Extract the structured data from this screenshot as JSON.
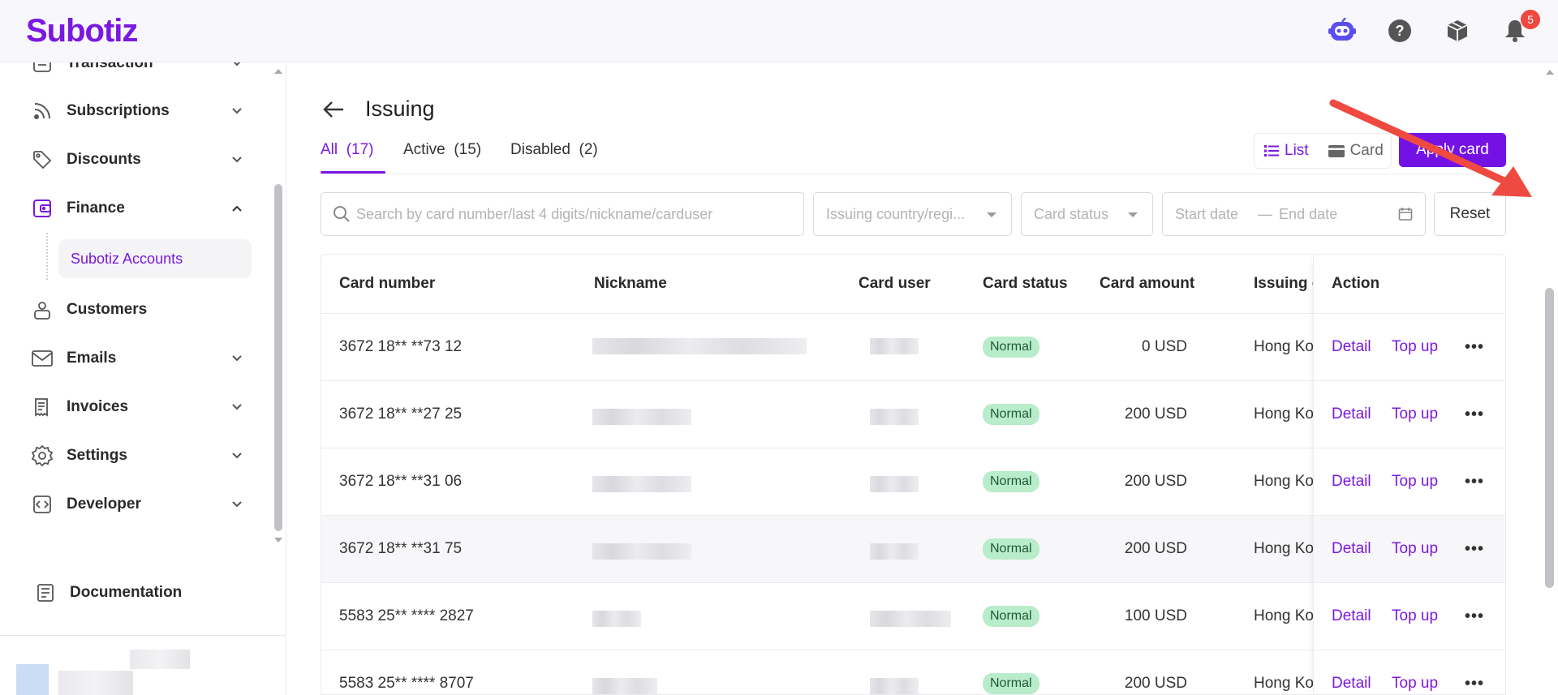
{
  "brand": {
    "name": "Subotiz",
    "color": "#7b18e0"
  },
  "header": {
    "icons": [
      "bot-icon",
      "help-icon",
      "package-icon",
      "bell-icon"
    ],
    "notification_count": "5"
  },
  "sidebar": {
    "items": [
      {
        "label": "Transaction",
        "icon": "receipt-icon",
        "expandable": true
      },
      {
        "label": "Subscriptions",
        "icon": "rss-icon",
        "expandable": true
      },
      {
        "label": "Discounts",
        "icon": "tag-icon",
        "expandable": true
      },
      {
        "label": "Finance",
        "icon": "wallet-icon",
        "expandable": true,
        "expanded": true
      },
      {
        "label": "Customers",
        "icon": "user-icon",
        "expandable": false
      },
      {
        "label": "Emails",
        "icon": "mail-icon",
        "expandable": true
      },
      {
        "label": "Invoices",
        "icon": "invoice-icon",
        "expandable": true
      },
      {
        "label": "Settings",
        "icon": "gear-icon",
        "expandable": true
      },
      {
        "label": "Developer",
        "icon": "code-icon",
        "expandable": true
      }
    ],
    "finance_sub": {
      "label": "Subotiz Accounts"
    },
    "documentation": {
      "label": "Documentation"
    }
  },
  "page": {
    "title": "Issuing",
    "tabs": [
      {
        "label": "All",
        "count": "(17)",
        "active": true
      },
      {
        "label": "Active",
        "count": "(15)"
      },
      {
        "label": "Disabled",
        "count": "(2)"
      }
    ],
    "view_toggle": {
      "list": "List",
      "card": "Card",
      "selected": "List"
    },
    "apply_label": "Apply card"
  },
  "filters": {
    "search_placeholder": "Search by card number/last 4 digits/nickname/carduser",
    "country_placeholder": "Issuing country/regi...",
    "status_placeholder": "Card status",
    "start_placeholder": "Start date",
    "date_sep": "—",
    "end_placeholder": "End date",
    "reset_label": "Reset"
  },
  "table": {
    "columns": [
      "Card number",
      "Nickname",
      "Card user",
      "Card status",
      "Card amount",
      "Issuing c",
      "Action"
    ],
    "rows": [
      {
        "card_number": "3672 18** **73 12",
        "status": "Normal",
        "amount": "0 USD",
        "country": "Hong Kon"
      },
      {
        "card_number": "3672 18** **27 25",
        "status": "Normal",
        "amount": "200 USD",
        "country": "Hong Kon"
      },
      {
        "card_number": "3672 18** **31 06",
        "status": "Normal",
        "amount": "200 USD",
        "country": "Hong Kon"
      },
      {
        "card_number": "3672 18** **31 75",
        "status": "Normal",
        "amount": "200 USD",
        "country": "Hong Kon"
      },
      {
        "card_number": "5583 25** **** 2827",
        "status": "Normal",
        "amount": "100 USD",
        "country": "Hong Kon"
      },
      {
        "card_number": "5583 25** **** 8707",
        "status": "Normal",
        "amount": "200 USD",
        "country": "Hong Kon"
      }
    ],
    "actions": {
      "detail": "Detail",
      "topup": "Top up",
      "more": "•••"
    }
  }
}
